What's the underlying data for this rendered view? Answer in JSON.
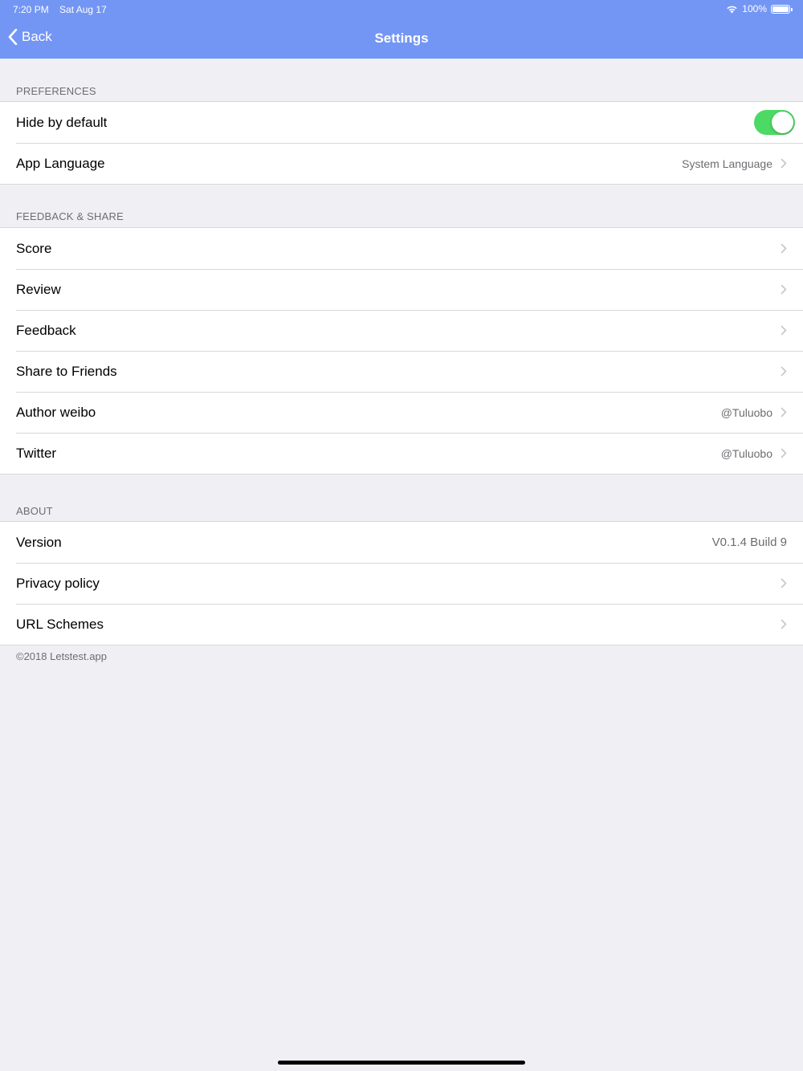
{
  "status": {
    "time": "7:20 PM",
    "date": "Sat Aug 17",
    "battery": "100%"
  },
  "nav": {
    "back_label": "Back",
    "title": "Settings"
  },
  "sections": {
    "preferences": {
      "header": "PREFERENCES",
      "hide_by_default": {
        "label": "Hide by default",
        "toggle_on": true
      },
      "app_language": {
        "label": "App Language",
        "value": "System Language"
      }
    },
    "feedback": {
      "header": "FEEDBACK & SHARE",
      "score": {
        "label": "Score"
      },
      "review": {
        "label": "Review"
      },
      "feedback": {
        "label": "Feedback"
      },
      "share": {
        "label": "Share to Friends"
      },
      "weibo": {
        "label": "Author weibo",
        "value": "@Tuluobo"
      },
      "twitter": {
        "label": "Twitter",
        "value": "@Tuluobo"
      }
    },
    "about": {
      "header": "ABOUT",
      "version": {
        "label": "Version",
        "value": "V0.1.4 Build 9"
      },
      "privacy": {
        "label": "Privacy policy"
      },
      "url_schemes": {
        "label": "URL Schemes"
      }
    }
  },
  "footer": "©2018 Letstest.app",
  "colors": {
    "nav_bar": "#7396f5",
    "background": "#efeff4",
    "toggle_on": "#4cd964"
  },
  "icons": [
    "wifi-icon",
    "battery-icon",
    "chevron-left-icon",
    "chevron-right-icon"
  ]
}
